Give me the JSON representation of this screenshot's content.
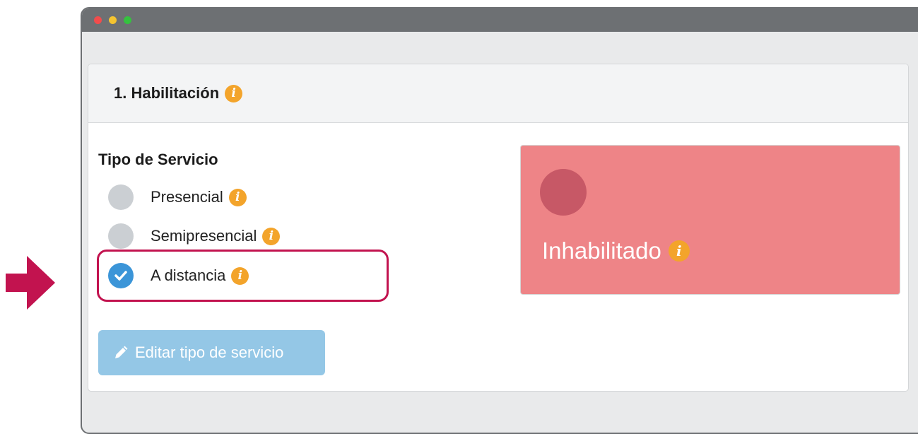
{
  "window": {
    "controls": [
      "close",
      "minimize",
      "maximize"
    ]
  },
  "panel": {
    "title": "1. Habilitación",
    "title_icon": "info-icon"
  },
  "service_type": {
    "label": "Tipo de Servicio",
    "options": [
      {
        "label": "Presencial",
        "selected": false
      },
      {
        "label": "Semipresencial",
        "selected": false
      },
      {
        "label": "A distancia",
        "selected": true
      }
    ]
  },
  "edit_button": {
    "label": "Editar tipo de servicio",
    "icon": "pencil-icon"
  },
  "status": {
    "label": "Inhabilitado",
    "icon": "info-icon"
  },
  "colors": {
    "accent_info": "#f3a42b",
    "highlight": "#c2134f",
    "status_bg": "#ee8487",
    "button_bg": "#94c7e6",
    "radio_checked": "#3b95d8"
  }
}
